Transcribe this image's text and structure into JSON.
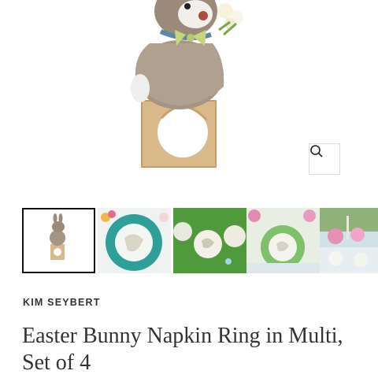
{
  "product": {
    "brand": "KIM SEYBERT",
    "title": "Easter Bunny Napkin Ring in Multi, Set of 4"
  },
  "gallery": {
    "main_image": "bunny-napkin-ring-photo",
    "zoom_icon": "search-icon",
    "thumbnails": [
      {
        "name": "bunny-napkin-ring",
        "selected": true
      },
      {
        "name": "turquoise-place-setting",
        "selected": false
      },
      {
        "name": "grass-table-setting",
        "selected": false
      },
      {
        "name": "floral-green-setting",
        "selected": false
      },
      {
        "name": "outdoor-table-scene",
        "selected": false
      }
    ]
  }
}
